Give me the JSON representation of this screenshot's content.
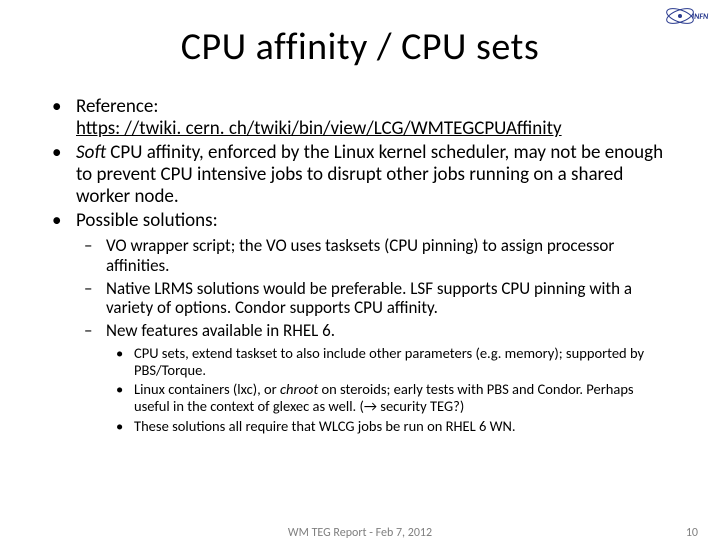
{
  "title": "CPU affinity / CPU sets",
  "bullets": {
    "b1_label": "Reference:",
    "b1_link_text": "https: //twiki. cern. ch/twiki/bin/view/LCG/WMTEGCPUAffinity",
    "b2_pre": "Soft",
    "b2_rest": " CPU affinity, enforced by the Linux kernel scheduler, may not be enough to prevent CPU intensive jobs to disrupt other jobs running on a shared worker node.",
    "b3": "Possible solutions:",
    "s1": "VO wrapper script; the VO uses tasksets (CPU pinning) to assign processor affinities.",
    "s2": "Native LRMS solutions would be preferable. LSF supports CPU pinning with a variety of options. Condor supports CPU affinity.",
    "s3": "New features available in RHEL 6.",
    "t1": "CPU sets, extend taskset to also include other parameters (e.g. memory); supported by PBS/Torque.",
    "t2_a": "Linux containers (lxc), or ",
    "t2_i": "chroot",
    "t2_b": " on steroids; early tests with PBS and Condor. Perhaps useful in the context of glexec as well. (→ security TEG?)",
    "t3": "These solutions all require that WLCG jobs be run on RHEL 6 WN."
  },
  "footer": {
    "date": "WM TEG Report - Feb 7, 2012",
    "page": "10"
  },
  "logo": {
    "label": "INFN"
  }
}
